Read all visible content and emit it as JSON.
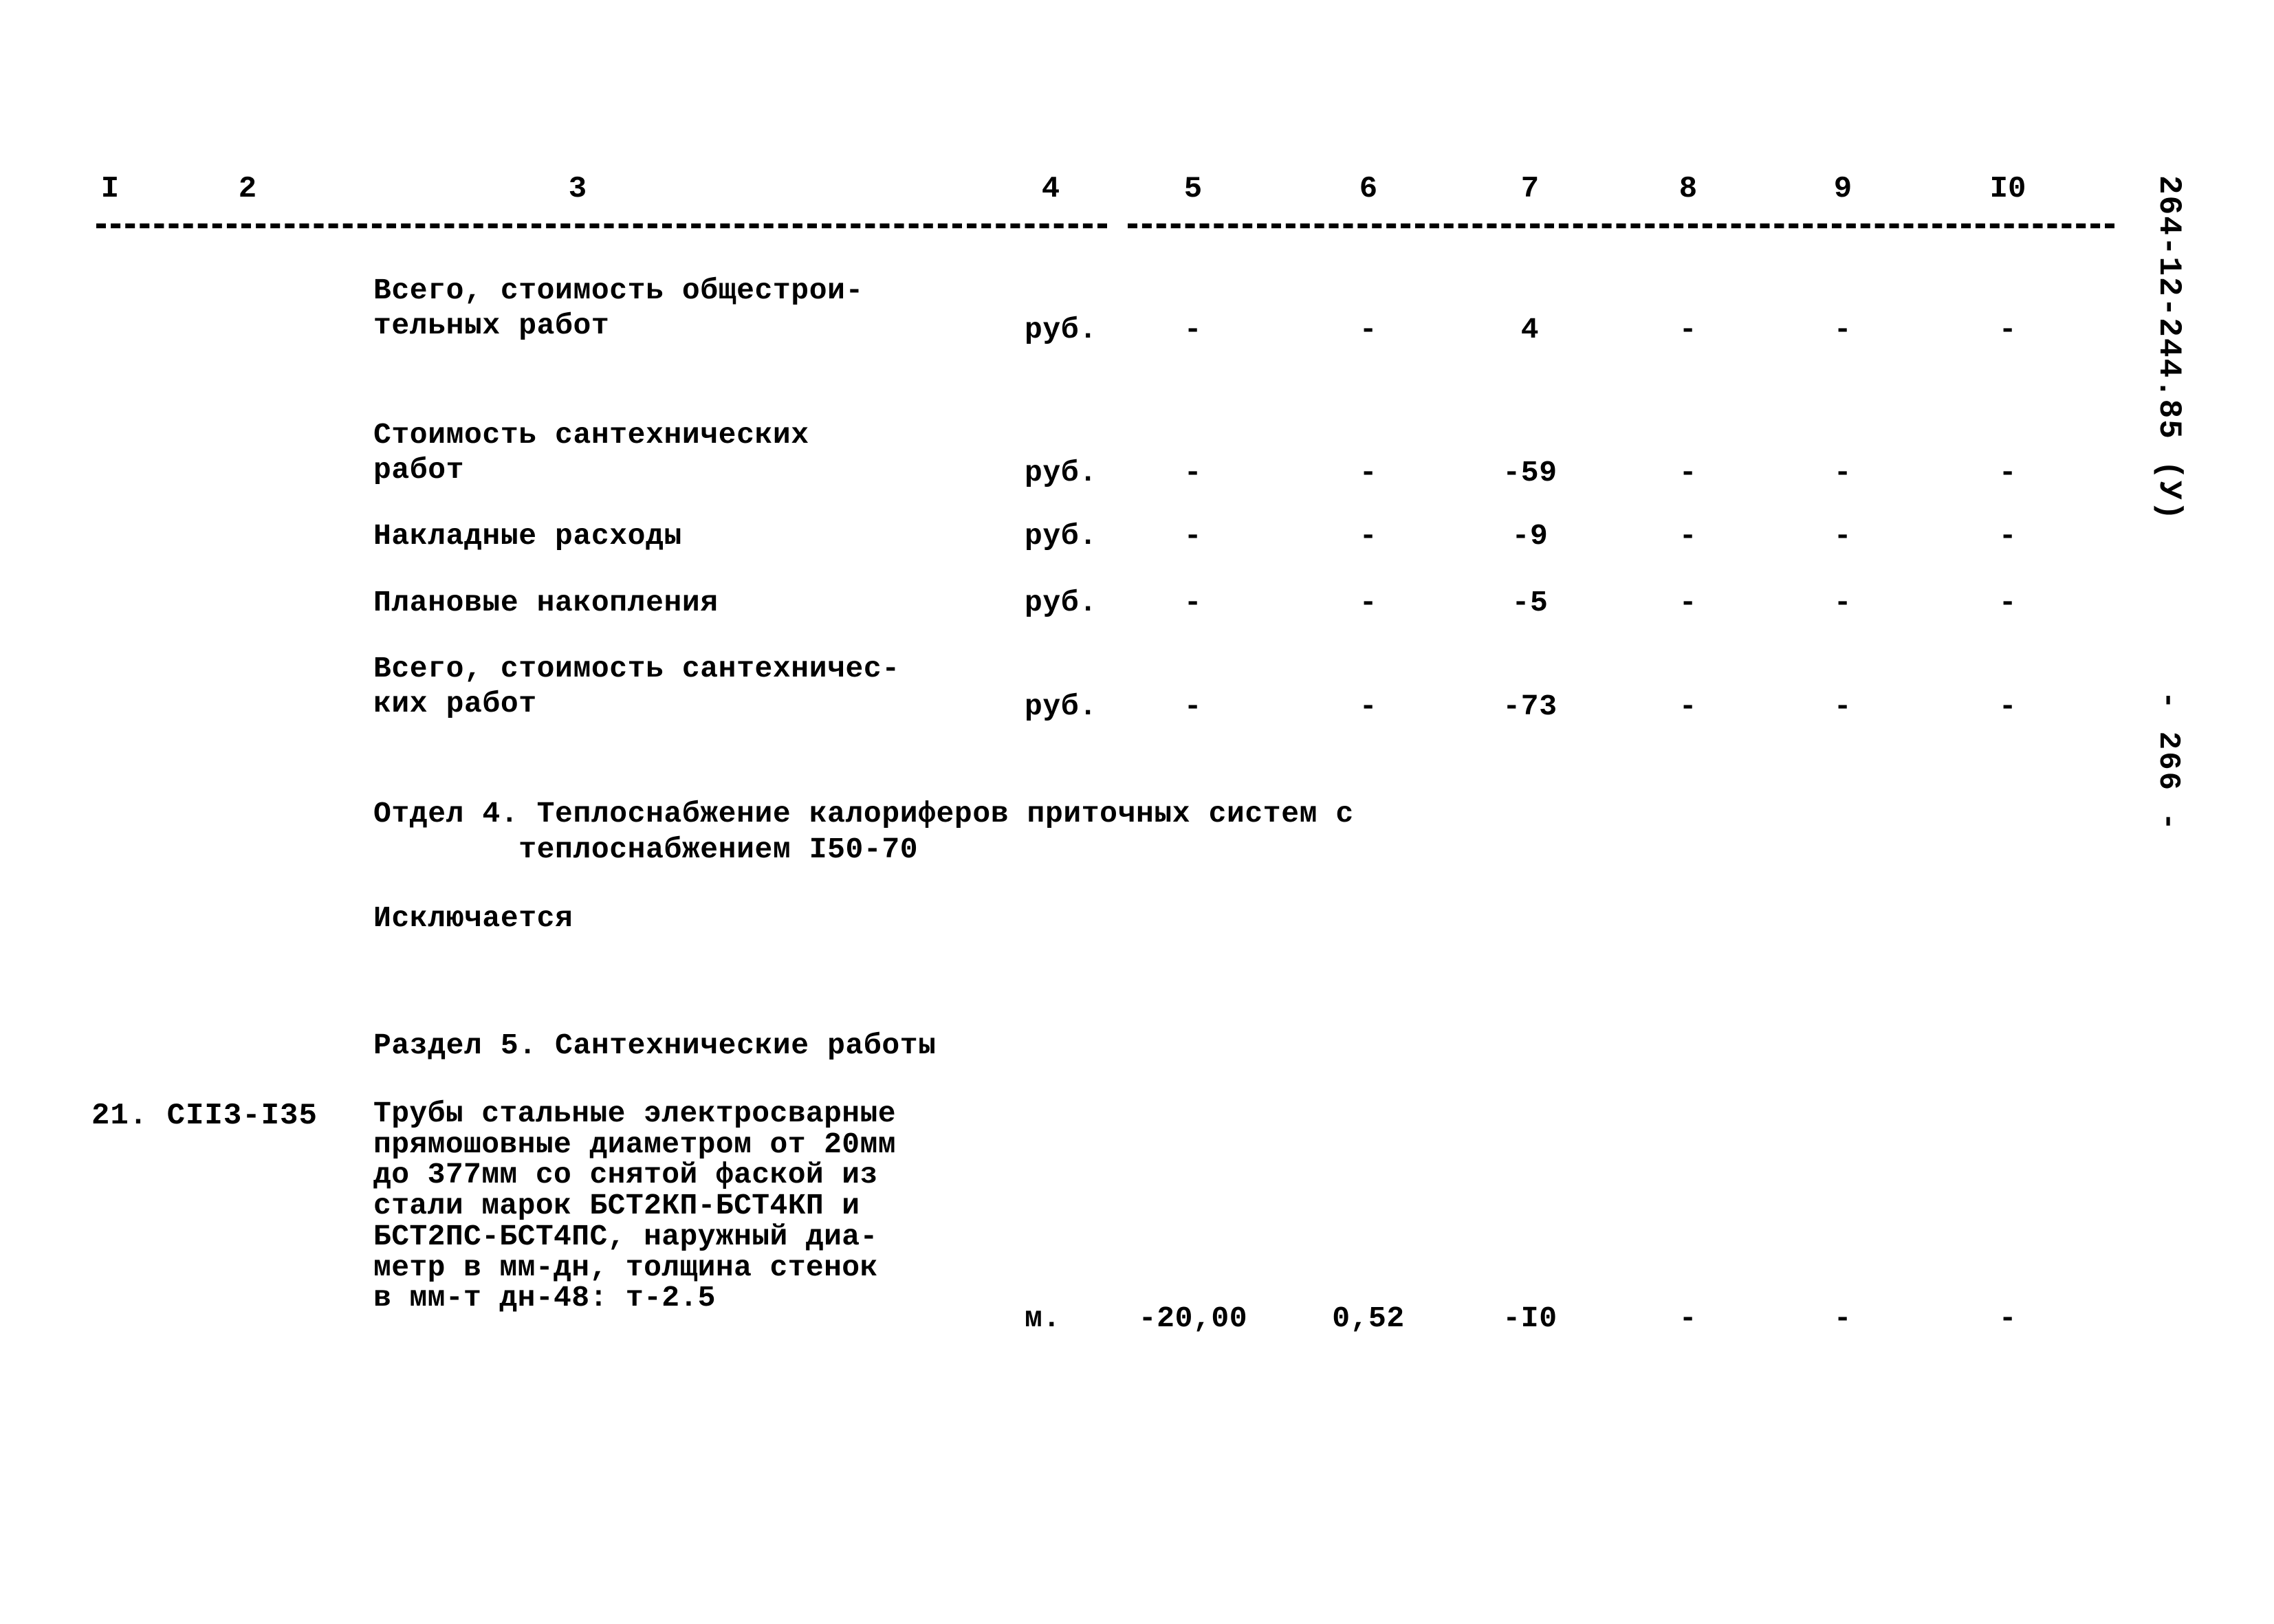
{
  "document": {
    "margin_code": "264-12-244.85 (У)",
    "page_marker": "- 266 -"
  },
  "table": {
    "column_headers": [
      "I",
      "2",
      "3",
      "4",
      "5",
      "6",
      "7",
      "8",
      "9",
      "I0"
    ],
    "rows": [
      {
        "description": "Всего, стоимость общестрои-\nтельных работ",
        "unit": "руб.",
        "c5": "-",
        "c6": "-",
        "c7": "4",
        "c8": "-",
        "c9": "-",
        "c10": "-"
      },
      {
        "description": "Стоимость сантехнических\nработ",
        "unit": "руб.",
        "c5": "-",
        "c6": "-",
        "c7": "-59",
        "c8": "-",
        "c9": "-",
        "c10": "-"
      },
      {
        "description": "Накладные расходы",
        "unit": "руб.",
        "c5": "-",
        "c6": "-",
        "c7": "-9",
        "c8": "-",
        "c9": "-",
        "c10": "-"
      },
      {
        "description": "Плановые накопления",
        "unit": "руб.",
        "c5": "-",
        "c6": "-",
        "c7": "-5",
        "c8": "-",
        "c9": "-",
        "c10": "-"
      },
      {
        "description": "Всего, стоимость сантехничес-\nких работ",
        "unit": "руб.",
        "c5": "-",
        "c6": "-",
        "c7": "-73",
        "c8": "-",
        "c9": "-",
        "c10": "-"
      }
    ]
  },
  "sections": {
    "otdel_4": "Отдел 4. Теплоснабжение калориферов приточных систем с\n        теплоснабжением I50-70",
    "otdel_4_note": "Исключается",
    "razdel_5": "Раздел 5. Сантехнические работы"
  },
  "item": {
    "number": "21. СII3-I35",
    "description": "Трубы стальные электросварные\nпрямошовные диаметром от 20мм\nдо 377мм со снятой фаской из\nстали марок БСТ2КП-БСТ4КП и\nБСТ2ПС-БСТ4ПС, наружный диа-\nметр в мм-дн, толщина стенок\nв мм-т дн-48: т-2.5",
    "unit": "м.",
    "c5": "-20,00",
    "c6": "0,52",
    "c7": "-I0",
    "c8": "-",
    "c9": "-",
    "c10": "-"
  }
}
